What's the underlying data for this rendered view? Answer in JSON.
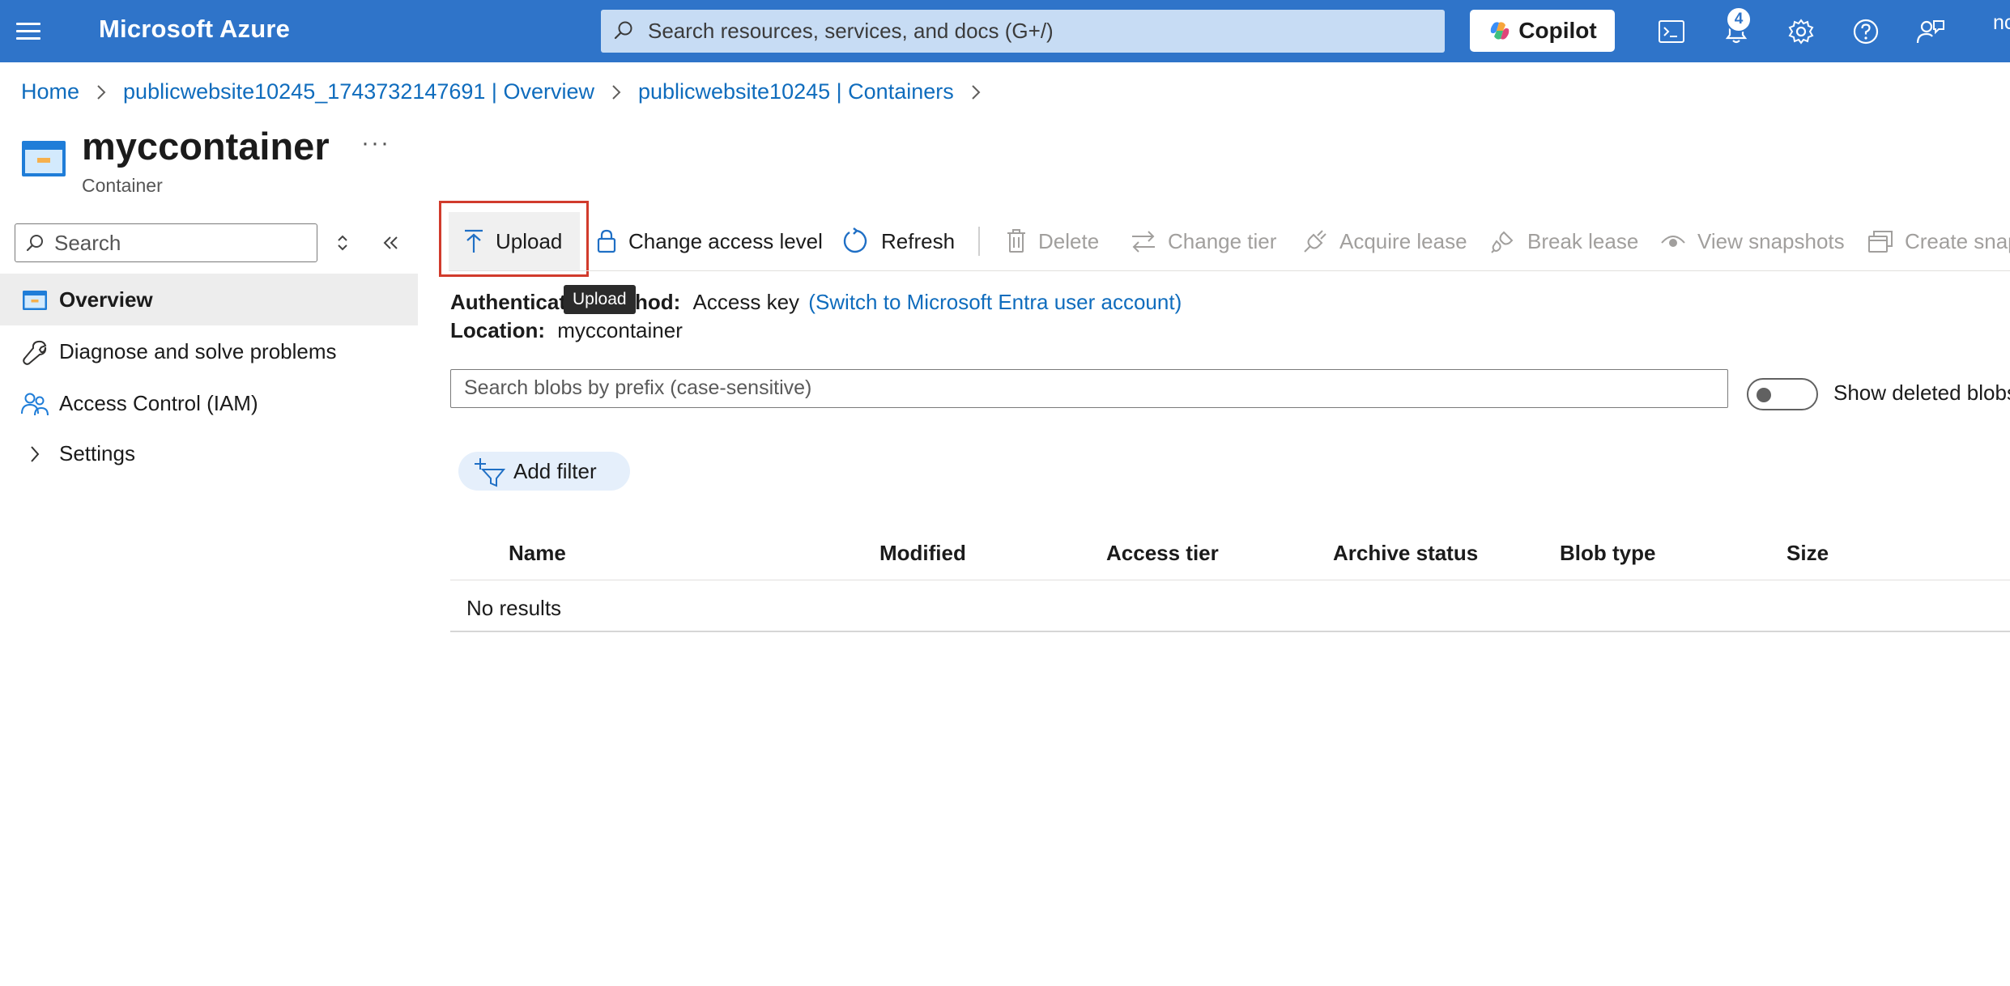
{
  "topbar": {
    "brand": "Microsoft Azure",
    "search_placeholder": "Search resources, services, and docs (G+/)",
    "copilot_label": "Copilot",
    "notification_count": "4",
    "user_fragment": "nc"
  },
  "breadcrumb": [
    "Home",
    "publicwebsite10245_1743732147691 | Overview",
    "publicwebsite10245 | Containers"
  ],
  "resource": {
    "title": "myccontainer",
    "more": "···",
    "subtitle": "Container"
  },
  "nav": {
    "search_placeholder": "Search",
    "items": [
      {
        "label": "Overview",
        "icon": "container-icon",
        "active": true
      },
      {
        "label": "Diagnose and solve problems",
        "icon": "wrench-icon"
      },
      {
        "label": "Access Control (IAM)",
        "icon": "people-icon"
      },
      {
        "label": "Settings",
        "icon": "chevron-right-icon"
      }
    ]
  },
  "toolbar": {
    "upload": "Upload",
    "change_access_level": "Change access level",
    "refresh": "Refresh",
    "delete": "Delete",
    "change_tier": "Change tier",
    "acquire_lease": "Acquire lease",
    "break_lease": "Break lease",
    "view_snapshots": "View snapshots",
    "create_snapshot": "Create snap"
  },
  "tooltip": "Upload",
  "essentials": {
    "auth_label_start": "Authenticat",
    "auth_label_end": "hod:",
    "auth_value": "Access key",
    "auth_link": "(Switch to Microsoft Entra user account)",
    "location_label": "Location:",
    "location_value": "myccontainer"
  },
  "blob_search_placeholder": "Search blobs by prefix (case-sensitive)",
  "show_deleted_label": "Show deleted blobs",
  "add_filter": "Add filter",
  "table": {
    "columns": [
      "Name",
      "Modified",
      "Access tier",
      "Archive status",
      "Blob type",
      "Size"
    ],
    "empty_text": "No results"
  },
  "colors": {
    "topbar": "#2f74c9",
    "link": "#0f6cbd",
    "highlight": "#d13b2c"
  }
}
